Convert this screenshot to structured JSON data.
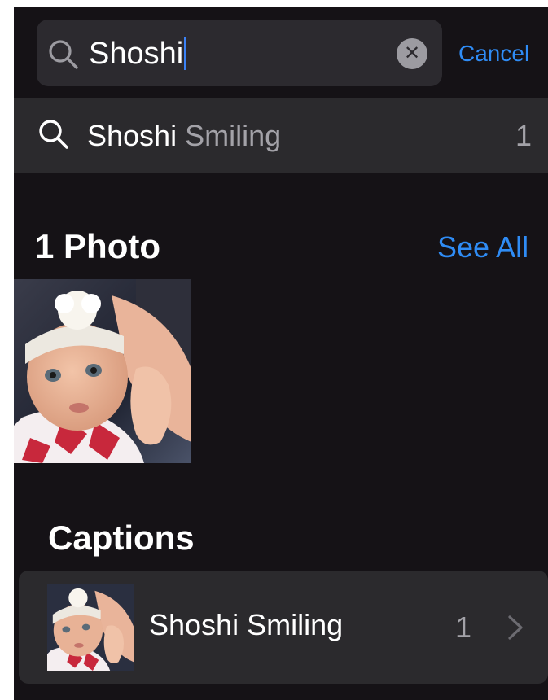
{
  "search": {
    "query": "Shoshi",
    "cancel_label": "Cancel",
    "clear_icon": "clear-icon",
    "search_icon": "magnifying-glass-icon"
  },
  "suggestion": {
    "match": "Shoshi",
    "rest": " Smiling",
    "count": "1"
  },
  "photos": {
    "title": "1 Photo",
    "see_all_label": "See All"
  },
  "captions": {
    "title": "Captions",
    "items": [
      {
        "label": "Shoshi Smiling",
        "count": "1",
        "chevron_icon": "chevron-right-icon"
      }
    ]
  },
  "colors": {
    "background": "#151216",
    "field": "#2c2a2f",
    "row": "#2b2a2d",
    "accent": "#2f8cf5",
    "secondary_text": "#a3a2a8"
  }
}
